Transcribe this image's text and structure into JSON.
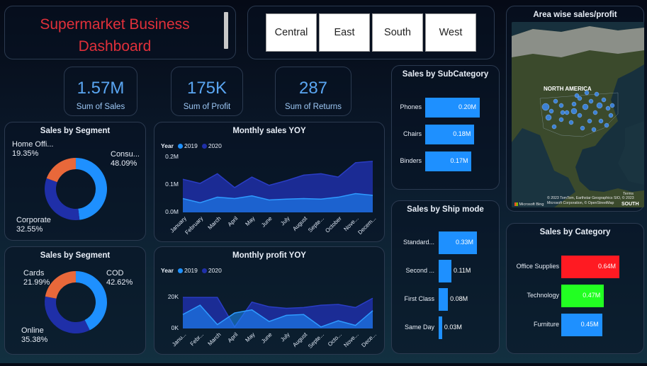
{
  "title": "Supermarket Business Dashboard",
  "slicer": [
    "Central",
    "East",
    "South",
    "West"
  ],
  "kpis": [
    {
      "value": "1.57M",
      "label": "Sum of Sales"
    },
    {
      "value": "175K",
      "label": "Sum of Profit"
    },
    {
      "value": "287",
      "label": "Sum of Returns"
    }
  ],
  "map": {
    "title": "Area wise sales/profit",
    "label_na": "NORTH AMERICA",
    "label_south": "SOUTH",
    "attribution": "© 2023 TomTom, Earthstar Geographics SIO, © 2023 Microsoft Corporation, © OpenStreetMap",
    "bing": "Microsoft Bing",
    "terms": "Terms"
  },
  "colors": {
    "accent": "#1e90ff",
    "dark_series": "#1f2fa8",
    "title_red": "#e0303a",
    "office": "#ff1a22",
    "tech": "#22ff22",
    "furn": "#1e90ff",
    "donut_orange": "#e8683a"
  },
  "charts": {
    "subcategory": {
      "title": "Sales by SubCategory",
      "type": "bar",
      "categories": [
        "Phones",
        "Chairs",
        "Binders"
      ],
      "values": [
        0.2,
        0.18,
        0.17
      ],
      "labels": [
        "0.20M",
        "0.18M",
        "0.17M"
      ]
    },
    "shipmode": {
      "title": "Sales by Ship mode",
      "type": "bar",
      "categories": [
        "Standard...",
        "Second ...",
        "First Class",
        "Same Day"
      ],
      "values": [
        0.33,
        0.11,
        0.08,
        0.03
      ],
      "labels": [
        "0.33M",
        "0.11M",
        "0.08M",
        "0.03M"
      ]
    },
    "category": {
      "title": "Sales by Category",
      "type": "bar",
      "categories": [
        "Office Supplies",
        "Technology",
        "Furniture"
      ],
      "values": [
        0.64,
        0.47,
        0.45
      ],
      "labels": [
        "0.64M",
        "0.47M",
        "0.45M"
      ],
      "colors": [
        "#ff1a22",
        "#22ff22",
        "#1e90ff"
      ]
    },
    "segment": {
      "title": "Sales by Segment",
      "type": "pie",
      "slices": [
        {
          "name": "Consu...",
          "pct": 48.09,
          "pct_label": "48.09%",
          "color": "#1e90ff"
        },
        {
          "name": "Corporate",
          "pct": 32.55,
          "pct_label": "32.55%",
          "color": "#1f2fa8"
        },
        {
          "name": "Home Offi...",
          "pct": 19.35,
          "pct_label": "19.35%",
          "color": "#e8683a"
        }
      ]
    },
    "payment": {
      "title": "Sales by Segment",
      "type": "pie",
      "slices": [
        {
          "name": "COD",
          "pct": 42.62,
          "pct_label": "42.62%",
          "color": "#1e90ff"
        },
        {
          "name": "Online",
          "pct": 35.38,
          "pct_label": "35.38%",
          "color": "#1f2fa8"
        },
        {
          "name": "Cards",
          "pct": 21.99,
          "pct_label": "21.99%",
          "color": "#e8683a"
        }
      ]
    },
    "monthly_sales": {
      "title": "Monthly sales YOY",
      "type": "area",
      "legend_title": "Year",
      "x": [
        "January",
        "February",
        "March",
        "April",
        "May",
        "June",
        "July",
        "August",
        "Septe...",
        "October",
        "Nove...",
        "Decem..."
      ],
      "yticks": [
        "0.0M",
        "0.1M",
        "0.2M"
      ],
      "ylim": [
        0,
        0.2
      ],
      "series": [
        {
          "name": "2019",
          "values": [
            0.05,
            0.035,
            0.055,
            0.05,
            0.06,
            0.045,
            0.048,
            0.05,
            0.048,
            0.055,
            0.068,
            0.062
          ]
        },
        {
          "name": "2020",
          "values": [
            0.12,
            0.105,
            0.14,
            0.09,
            0.128,
            0.098,
            0.115,
            0.135,
            0.14,
            0.128,
            0.18,
            0.185
          ]
        }
      ]
    },
    "monthly_profit": {
      "title": "Monthly profit YOY",
      "type": "area",
      "legend_title": "Year",
      "x": [
        "Janu...",
        "Febr...",
        "March",
        "April",
        "May",
        "June",
        "July",
        "August",
        "Septe...",
        "Octo...",
        "Nove...",
        "Dece..."
      ],
      "yticks": [
        "0K",
        "20K"
      ],
      "ylim": [
        0,
        26000
      ],
      "series": [
        {
          "name": "2019",
          "values": [
            9000,
            15000,
            2500,
            10000,
            12000,
            4500,
            8500,
            9000,
            1000,
            5000,
            2000,
            11500
          ]
        },
        {
          "name": "2020",
          "values": [
            20000,
            20000,
            20000,
            1000,
            17000,
            14000,
            13000,
            13500,
            15000,
            15500,
            13500,
            19500
          ]
        }
      ]
    }
  }
}
